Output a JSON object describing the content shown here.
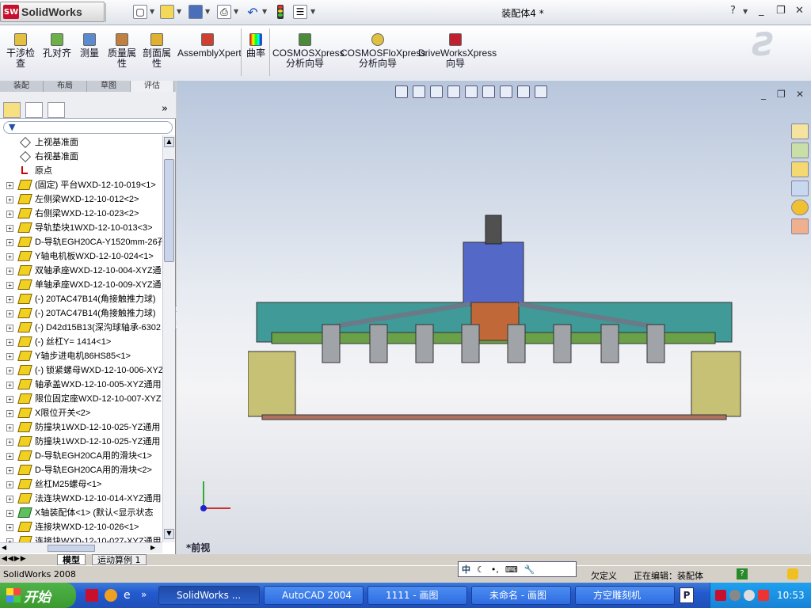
{
  "app": {
    "name": "SolidWorks",
    "doc_title": "装配体4 *"
  },
  "title_controls": {
    "help": "?",
    "min": "_",
    "restore": "❐",
    "close": "✕"
  },
  "ribbon": [
    {
      "label": "干涉检\n查"
    },
    {
      "label": "孔对齐"
    },
    {
      "label": "测量"
    },
    {
      "label": "质量属\n性"
    },
    {
      "label": "剖面属\n性"
    },
    {
      "label": "AssemblyXpert"
    },
    {
      "label": "曲率"
    },
    {
      "label": "COSMOSXpress\n分析向导"
    },
    {
      "label": "COSMOSFloXpress\n分析向导"
    },
    {
      "label": "DriveWorksXpress\n向导"
    }
  ],
  "command_tabs": [
    "装配",
    "布局",
    "草图",
    "评估"
  ],
  "tree": [
    {
      "label": "上视基准面",
      "icon": "plane"
    },
    {
      "label": "右视基准面",
      "icon": "plane"
    },
    {
      "label": "原点",
      "icon": "origin"
    },
    {
      "label": "(固定) 平台WXD-12-10-019<1>",
      "icon": "part"
    },
    {
      "label": "左侧梁WXD-12-10-012<2>",
      "icon": "part"
    },
    {
      "label": "右侧梁WXD-12-10-023<2>",
      "icon": "part"
    },
    {
      "label": "导轨垫块1WXD-12-10-013<3>",
      "icon": "part"
    },
    {
      "label": "D-导轨EGH20CA-Y1520mm-26孔<",
      "icon": "part"
    },
    {
      "label": "Y轴电机板WXD-12-10-024<1>",
      "icon": "part"
    },
    {
      "label": "双轴承座WXD-12-10-004-XYZ通",
      "icon": "part"
    },
    {
      "label": "单轴承座WXD-12-10-009-XYZ通",
      "icon": "part"
    },
    {
      "label": "(-) 20TAC47B14(角接触推力球)",
      "icon": "part"
    },
    {
      "label": "(-) 20TAC47B14(角接触推力球)",
      "icon": "part"
    },
    {
      "label": "(-) D42d15B13(深沟球轴承-6302",
      "icon": "part"
    },
    {
      "label": "(-) 丝杠Y= 1414<1>",
      "icon": "part"
    },
    {
      "label": "Y轴步进电机86HS85<1>",
      "icon": "part"
    },
    {
      "label": "(-) 锁紧螺母WXD-12-10-006-XYZ",
      "icon": "part"
    },
    {
      "label": "轴承盖WXD-12-10-005-XYZ通用",
      "icon": "part"
    },
    {
      "label": "限位固定座WXD-12-10-007-XYZ",
      "icon": "part"
    },
    {
      "label": "X限位开关<2>",
      "icon": "part"
    },
    {
      "label": "防撞块1WXD-12-10-025-YZ通用",
      "icon": "part"
    },
    {
      "label": "防撞块1WXD-12-10-025-YZ通用",
      "icon": "part"
    },
    {
      "label": "D-导轨EGH20CA用的滑块<1>",
      "icon": "part"
    },
    {
      "label": "D-导轨EGH20CA用的滑块<2>",
      "icon": "part"
    },
    {
      "label": "丝杠M25螺母<1>",
      "icon": "part"
    },
    {
      "label": "法连块WXD-12-10-014-XYZ通用",
      "icon": "part"
    },
    {
      "label": "X轴装配体<1> (默认<显示状态",
      "icon": "asm"
    },
    {
      "label": "连接块WXD-12-10-026<1>",
      "icon": "part"
    },
    {
      "label": "连接块WXD-12-10-027-XYZ通用",
      "icon": "part"
    }
  ],
  "bottom_tabs": [
    "模型",
    "运动算例 1"
  ],
  "viewport": {
    "view_label": "*前视"
  },
  "status": {
    "app": "SolidWorks 2008",
    "left_status": "欠定义",
    "editing": "正在编辑：装配体",
    "help": "?"
  },
  "taskbar": {
    "start": "开始",
    "tasks": [
      "SolidWorks ...",
      "AutoCAD 2004",
      "1111 - 画图",
      "未命名 - 画图",
      "方空雕刻机"
    ],
    "clock": "10:53"
  }
}
